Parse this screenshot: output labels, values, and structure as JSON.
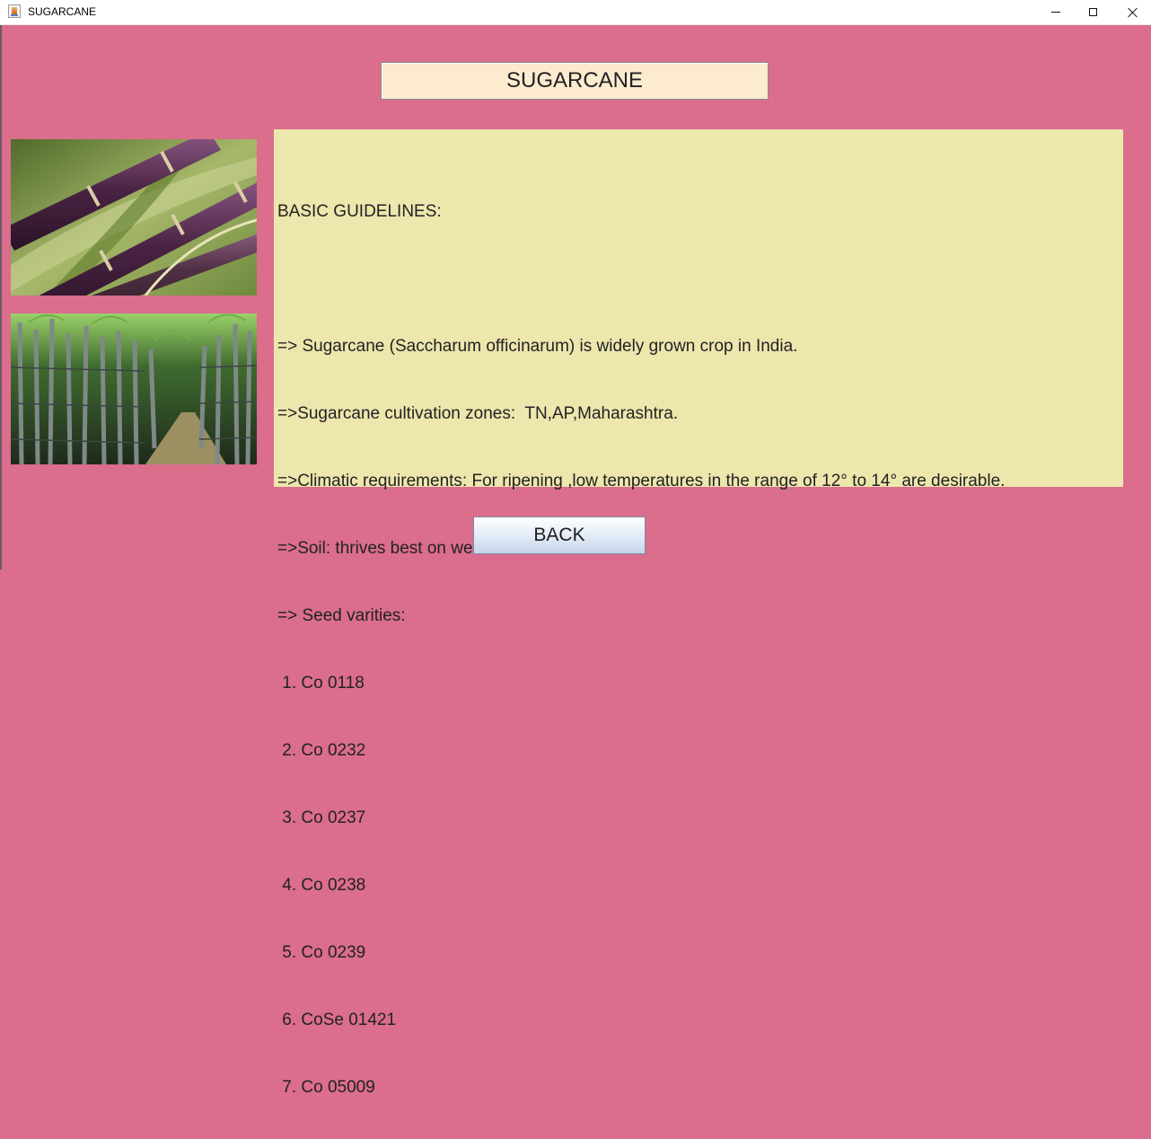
{
  "window": {
    "title": "SUGARCANE"
  },
  "heading": "SUGARCANE",
  "images": {
    "top": "sugarcane stalks close-up photo",
    "bottom": "sugarcane field rows photo"
  },
  "guidelines": {
    "lines": [
      "BASIC GUIDELINES:",
      "",
      "=> Sugarcane (Saccharum officinarum) is widely grown crop in India.",
      "=>Sugarcane cultivation zones:  TN,AP,Maharashtra.",
      "=>Climatic requirements: For ripening ,low temperatures in the range of 12° to 14° are desirable.",
      "=>Soil: thrives best on well drained soils.",
      "=> Seed varities:",
      " 1. Co 0118",
      " 2. Co 0232",
      " 3. Co 0237",
      " 4. Co 0238",
      " 5. Co 0239",
      " 6. CoSe 01421",
      " 7. Co 05009"
    ]
  },
  "back_button": "BACK",
  "colors": {
    "background": "#db6d8d",
    "heading_bg": "#fdebd0",
    "panel_bg": "#ede6ad"
  }
}
